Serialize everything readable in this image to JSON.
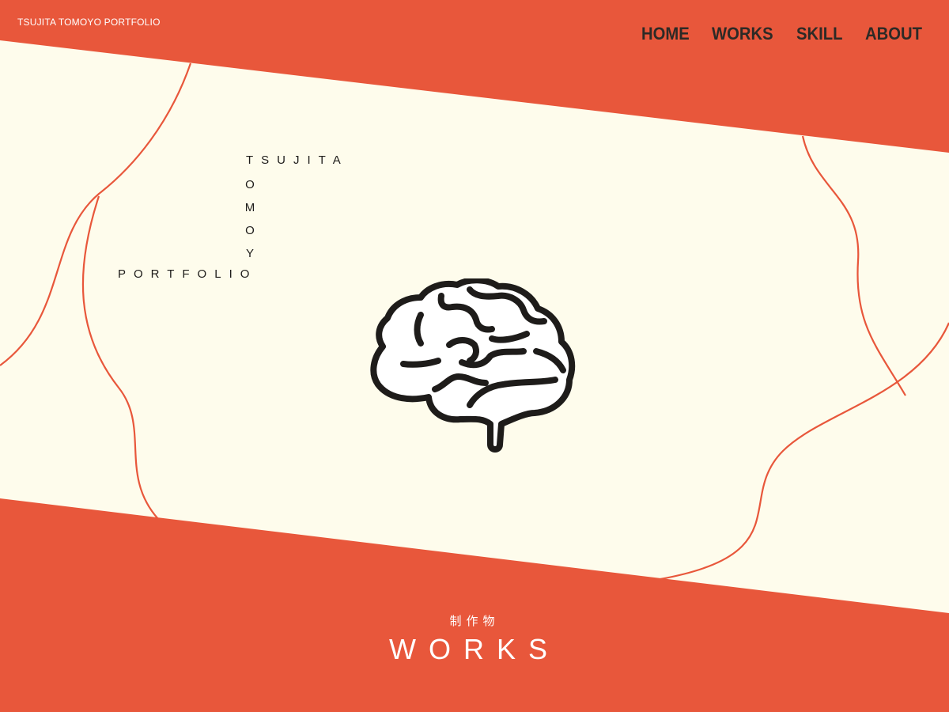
{
  "header": {
    "site_title": "TSUJITA TOMOYO PORTFOLIO",
    "nav": [
      {
        "label": "HOME"
      },
      {
        "label": "WORKS"
      },
      {
        "label": "SKILL"
      },
      {
        "label": "ABOUT"
      }
    ]
  },
  "hero": {
    "logo_line1": "TSUJITA",
    "logo_vertical": [
      "T",
      "O",
      "M",
      "O",
      "Y",
      "O"
    ],
    "logo_line3": "PORTFOLIO",
    "illustration": "brain-icon"
  },
  "section": {
    "subtitle": "制作物",
    "title": "WORKS"
  },
  "colors": {
    "accent": "#e8573b",
    "background": "#fefcec",
    "text": "#2d2a26",
    "brain_highlight": "#a9dbd4"
  }
}
